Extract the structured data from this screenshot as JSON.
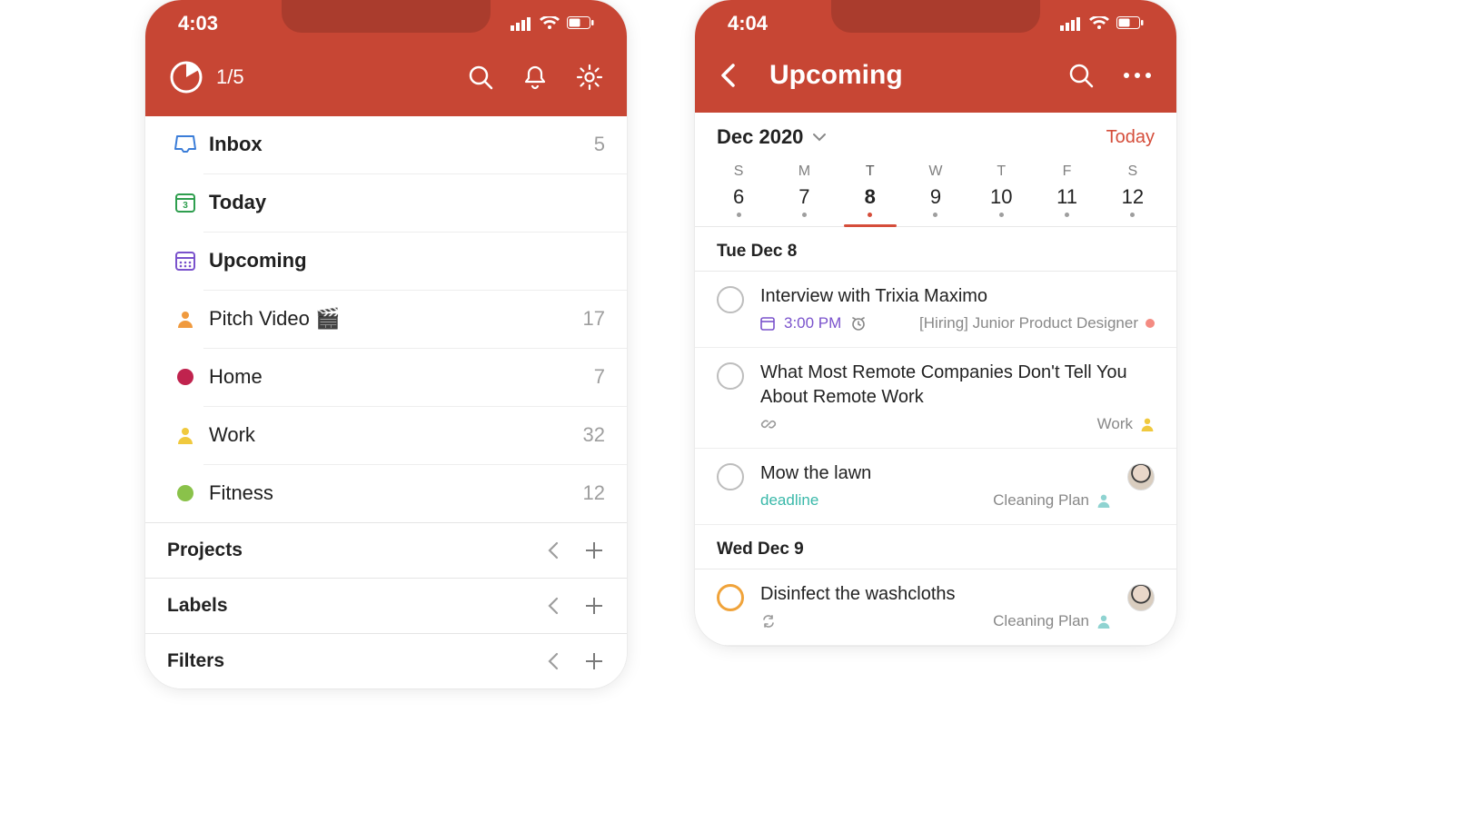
{
  "left": {
    "status_time": "4:03",
    "counter": "1/5",
    "nav": [
      {
        "label": "Inbox",
        "count": "5"
      },
      {
        "label": "Today",
        "count": ""
      },
      {
        "label": "Upcoming",
        "count": ""
      }
    ],
    "projects": [
      {
        "label": "Pitch Video 🎬",
        "count": "17",
        "icon": "person",
        "color": "#f09a3e"
      },
      {
        "label": "Home",
        "count": "7",
        "icon": "dot",
        "color": "#c0234e"
      },
      {
        "label": "Work",
        "count": "32",
        "icon": "person",
        "color": "#f0c93e"
      },
      {
        "label": "Fitness",
        "count": "12",
        "icon": "dot",
        "color": "#8ac24a"
      }
    ],
    "sections": [
      {
        "label": "Projects"
      },
      {
        "label": "Labels"
      },
      {
        "label": "Filters"
      }
    ]
  },
  "right": {
    "status_time": "4:04",
    "title": "Upcoming",
    "month": "Dec 2020",
    "today_label": "Today",
    "weekdays": [
      "S",
      "M",
      "T",
      "W",
      "T",
      "F",
      "S"
    ],
    "dates": [
      "6",
      "7",
      "8",
      "9",
      "10",
      "11",
      "12"
    ],
    "selected_index": 2,
    "groups": [
      {
        "heading": "Tue Dec 8",
        "tasks": [
          {
            "title": "Interview with Trixia Maximo",
            "time": "3:00 PM",
            "has_reminder": true,
            "project": "[Hiring] Junior Product Designer",
            "project_color": "#f48b82",
            "tag": "",
            "link": false,
            "repeat": false,
            "avatar": false,
            "priority": false,
            "meta_project_icon": "dot"
          },
          {
            "title": "What Most Remote Companies Don't Tell You About Remote Work",
            "time": "",
            "has_reminder": false,
            "project": "Work",
            "project_color": "#f0c93e",
            "tag": "",
            "link": true,
            "repeat": false,
            "avatar": false,
            "priority": false,
            "meta_project_icon": "person"
          },
          {
            "title": "Mow the lawn",
            "time": "",
            "has_reminder": false,
            "project": "Cleaning Plan",
            "project_color": "#8fd3d1",
            "tag": "deadline",
            "link": false,
            "repeat": false,
            "avatar": true,
            "priority": false,
            "meta_project_icon": "person"
          }
        ]
      },
      {
        "heading": "Wed Dec 9",
        "tasks": [
          {
            "title": "Disinfect the washcloths",
            "time": "",
            "has_reminder": false,
            "project": "Cleaning Plan",
            "project_color": "#8fd3d1",
            "tag": "",
            "link": false,
            "repeat": true,
            "avatar": true,
            "priority": true,
            "meta_project_icon": "person"
          }
        ]
      }
    ]
  }
}
